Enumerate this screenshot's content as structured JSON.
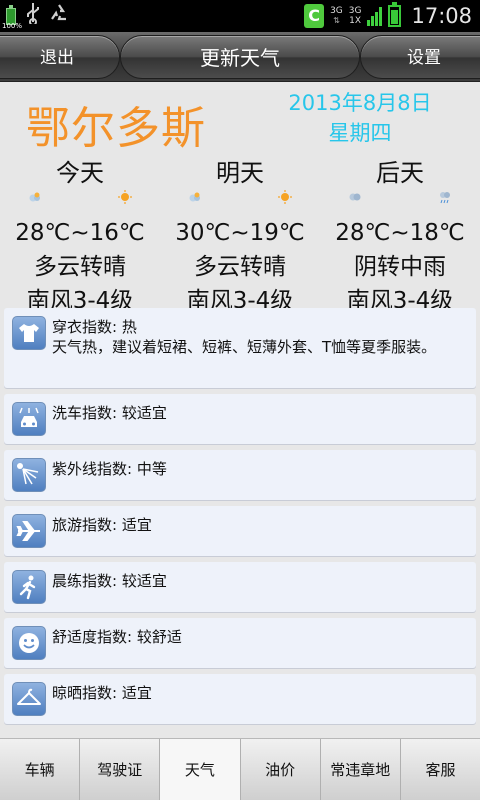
{
  "status_bar": {
    "battery_small_text": "100%",
    "time": "17:08",
    "network_top": "3G",
    "network_bottom": "3G",
    "network_bottom_sub": "1X",
    "app_notification": "C"
  },
  "header": {
    "left_button": "退出",
    "title": "更新天气",
    "right_button": "设置"
  },
  "weather": {
    "city": "鄂尔多斯",
    "date": "2013年8月8日",
    "weekday": "星期四",
    "days": [
      {
        "name": "今天",
        "temp": "28℃~16℃",
        "desc": "多云转晴",
        "wind": "南风3-4级",
        "icon_left": "cloud-icon",
        "icon_right": "sun-icon"
      },
      {
        "name": "明天",
        "temp": "30℃~19℃",
        "desc": "多云转晴",
        "wind": "南风3-4级",
        "icon_left": "cloud-icon",
        "icon_right": "sun-icon"
      },
      {
        "name": "后天",
        "temp": "28℃~18℃",
        "desc": "阴转中雨",
        "wind": "南风3-4级",
        "icon_left": "overcast-icon",
        "icon_right": "rain-icon"
      }
    ]
  },
  "indices": [
    {
      "icon": "tshirt-icon",
      "title": "穿衣指数: 热",
      "desc": "天气热，建议着短裙、短裤、短薄外套、T恤等夏季服装。"
    },
    {
      "icon": "car-wash-icon",
      "title": "洗车指数: 较适宜",
      "desc": ""
    },
    {
      "icon": "uv-sun-icon",
      "title": "紫外线指数: 中等",
      "desc": ""
    },
    {
      "icon": "airplane-icon",
      "title": "旅游指数: 适宜",
      "desc": ""
    },
    {
      "icon": "runner-icon",
      "title": "晨练指数: 较适宜",
      "desc": ""
    },
    {
      "icon": "smiley-icon",
      "title": "舒适度指数: 较舒适",
      "desc": ""
    },
    {
      "icon": "hanger-icon",
      "title": "晾晒指数: 适宜",
      "desc": ""
    }
  ],
  "tabs": [
    {
      "label": "车辆",
      "active": false
    },
    {
      "label": "驾驶证",
      "active": false
    },
    {
      "label": "天气",
      "active": true
    },
    {
      "label": "油价",
      "active": false
    },
    {
      "label": "常违章地",
      "active": false
    },
    {
      "label": "客服",
      "active": false
    }
  ],
  "colors": {
    "city": "#f3922a",
    "date": "#27c6ea",
    "card_bg": "#eef2fa",
    "icon_bg": "#5f8dcc"
  }
}
